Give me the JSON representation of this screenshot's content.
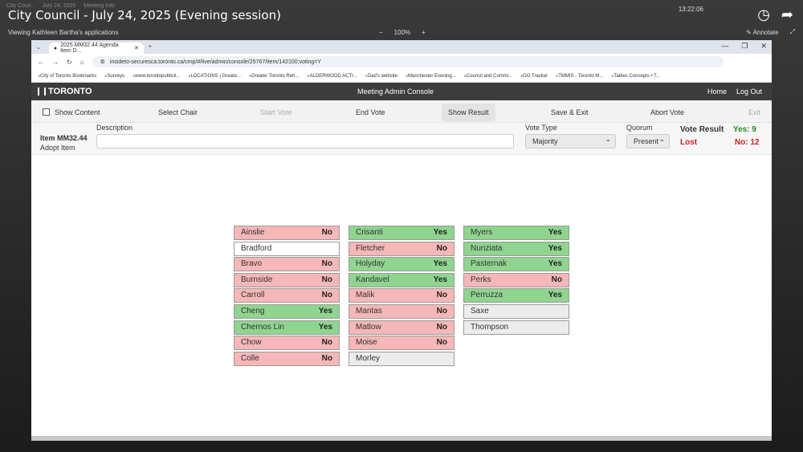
{
  "youtube": {
    "title": "City Council - July 24, 2025 (Evening session)",
    "meeting_strip": [
      "City Coun..",
      "July 24, 2025",
      "Meeting Info"
    ],
    "clock": "13:22:06",
    "controls": [
      {
        "icon": "clock-icon",
        "glyph": "◷",
        "label": ""
      },
      {
        "icon": "share-icon",
        "glyph": "➦",
        "label": ""
      }
    ]
  },
  "share_bar": {
    "viewing": "Viewing Kathleen Bartha's applications",
    "zoom_minus": "−",
    "zoom": "100%",
    "zoom_plus": "+",
    "annotate": "Annotate",
    "layout": "Layout"
  },
  "browser": {
    "tab_title": "2025.MM32.44 Agenda Item D...",
    "new_tab": "+",
    "url": "insideto-securesca.toronto.ca/cmp/#/live/admin/console/25767/item/142100;voting=Y",
    "bookmarks": [
      "City of Toronto Bookmarks",
      "Surveys",
      "www.torontopublicli...",
      "LOCATIONS | Greate...",
      "Greater Toronto Reh...",
      "ALDERWOOD ACTI...",
      "Dad's website",
      "Manchester Evening...",
      "Council and Commi...",
      "GO Tracker",
      "TMMIS - Toronto M...",
      "Tables Concepts • T..."
    ]
  },
  "app": {
    "logo": "TORONTO",
    "title": "Meeting Admin Console",
    "links": [
      "Home",
      "Log Out"
    ]
  },
  "toolbar": {
    "show_content": "Show Content",
    "select_chair": "Select Chair",
    "start_vote": "Start Vote",
    "end_vote": "End Vote",
    "show_result": "Show Result",
    "save_exit": "Save & Exit",
    "abort_vote": "Abort Vote",
    "exit": "Exit"
  },
  "item": {
    "id": "Item MM32.44",
    "action": "Adopt Item",
    "description_label": "Description",
    "description_value": "",
    "vote_type_label": "Vote Type",
    "vote_type_value": "Majority",
    "quorum_label": "Quorum",
    "quorum_value": "Present",
    "vote_result_label": "Vote Result",
    "vote_result_value": "Lost",
    "yes_count": "Yes: 9",
    "no_count": "No: 12",
    "colors": {
      "yes": "#1f8b1f",
      "no": "#d02020"
    }
  },
  "votes": [
    [
      {
        "name": "Ainslie",
        "vote": "No"
      },
      {
        "name": "Bradford",
        "vote": ""
      },
      {
        "name": "Bravo",
        "vote": "No"
      },
      {
        "name": "Burnside",
        "vote": "No"
      },
      {
        "name": "Carroll",
        "vote": "No"
      },
      {
        "name": "Cheng",
        "vote": "Yes"
      },
      {
        "name": "Chernos Lin",
        "vote": "Yes"
      },
      {
        "name": "Chow",
        "vote": "No"
      },
      {
        "name": "Colle",
        "vote": "No"
      }
    ],
    [
      {
        "name": "Crisanti",
        "vote": "Yes"
      },
      {
        "name": "Fletcher",
        "vote": "No"
      },
      {
        "name": "Holyday",
        "vote": "Yes"
      },
      {
        "name": "Kandavel",
        "vote": "Yes"
      },
      {
        "name": "Malik",
        "vote": "No"
      },
      {
        "name": "Mantas",
        "vote": "No"
      },
      {
        "name": "Matlow",
        "vote": "No"
      },
      {
        "name": "Moise",
        "vote": "No"
      },
      {
        "name": "Morley",
        "vote": ""
      }
    ],
    [
      {
        "name": "Myers",
        "vote": "Yes"
      },
      {
        "name": "Nunziata",
        "vote": "Yes"
      },
      {
        "name": "Pasternak",
        "vote": "Yes"
      },
      {
        "name": "Perks",
        "vote": "No"
      },
      {
        "name": "Perruzza",
        "vote": "Yes"
      },
      {
        "name": "Saxe",
        "vote": ""
      },
      {
        "name": "Thompson",
        "vote": ""
      }
    ]
  ]
}
